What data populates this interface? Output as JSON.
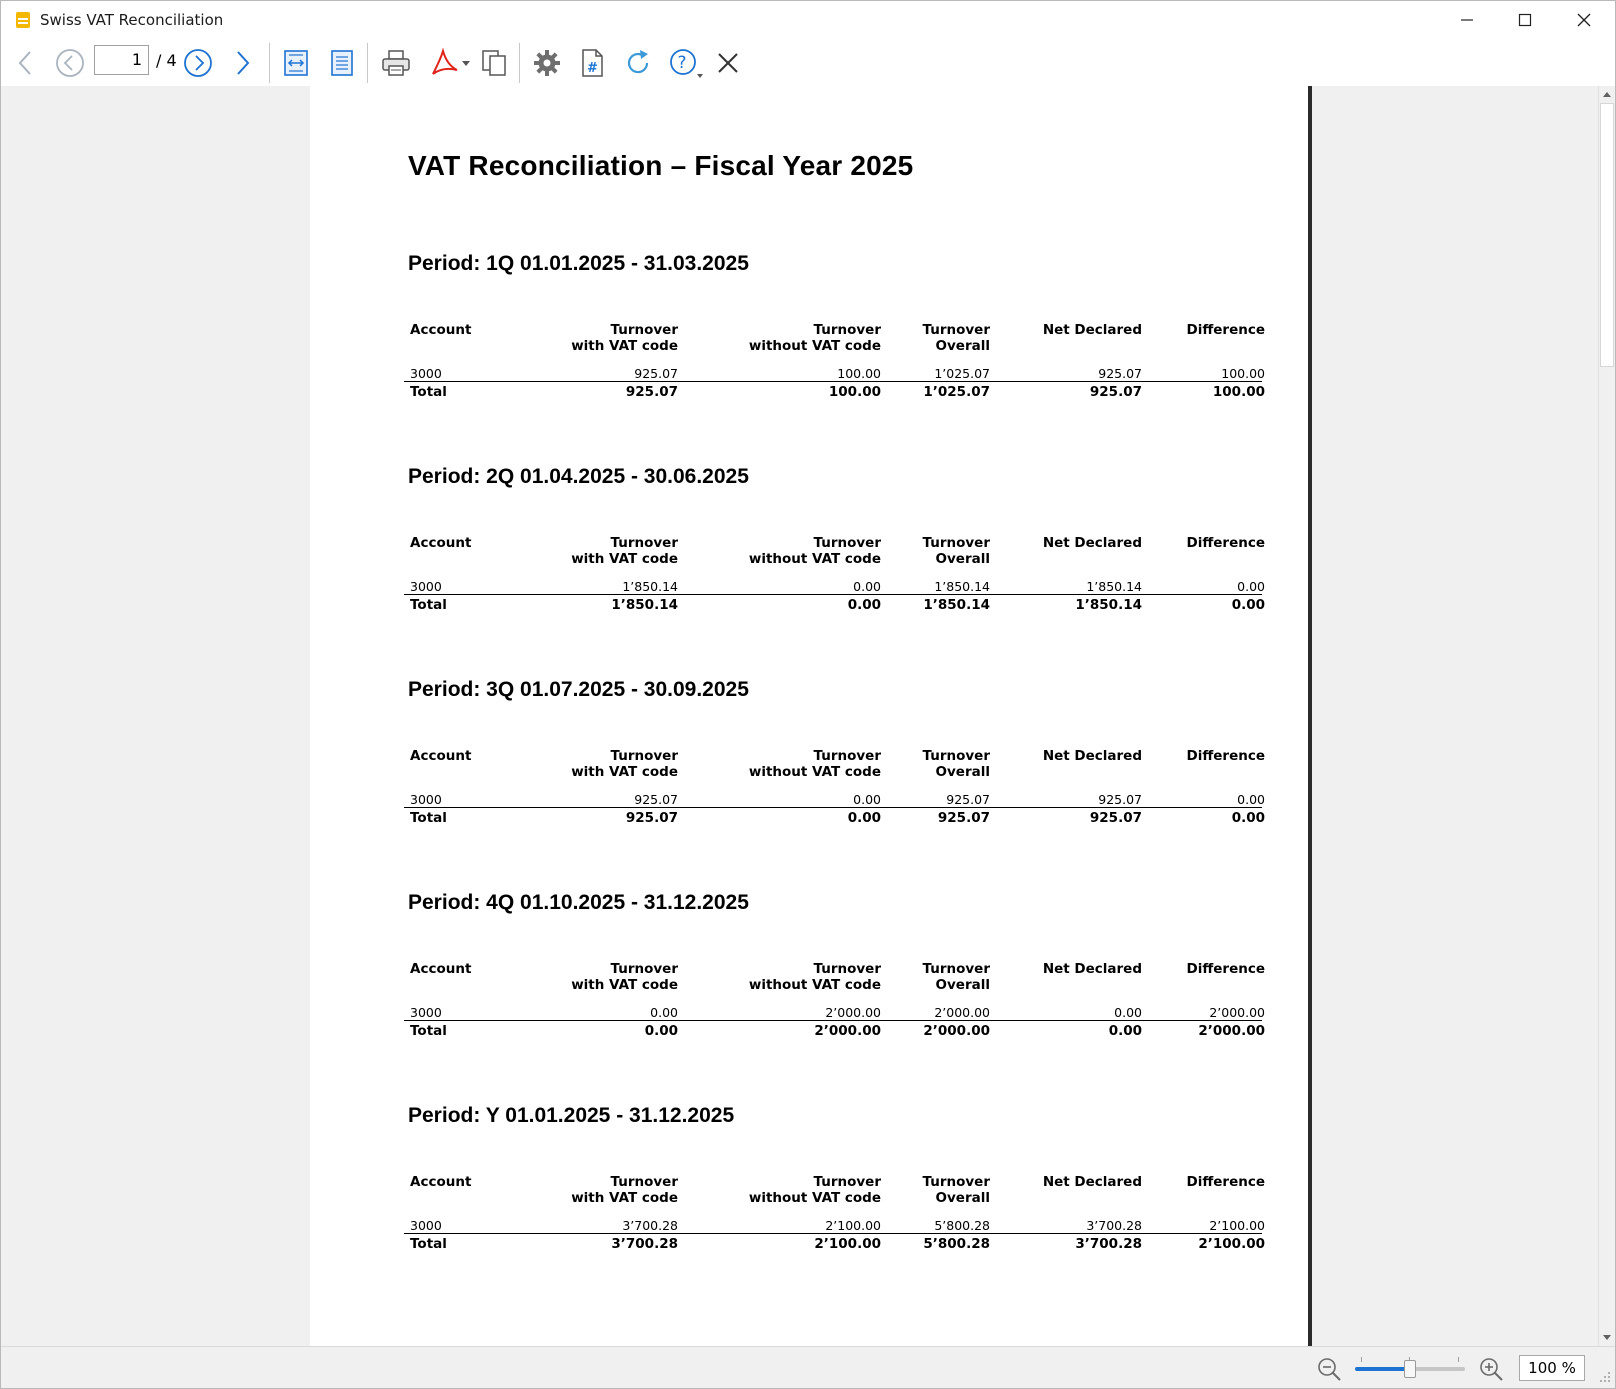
{
  "window": {
    "title": "Swiss VAT Reconciliation"
  },
  "toolbar": {
    "page_current": "1",
    "page_total": "/ 4",
    "icons": [
      "arrow-left-icon",
      "circle-arrow-left-icon",
      "circle-arrow-right-icon",
      "arrow-right-icon",
      "fit-width-icon",
      "fit-page-icon",
      "print-icon",
      "pdf-export-icon",
      "copy-pages-icon",
      "settings-gear-icon",
      "page-number-icon",
      "refresh-icon",
      "help-icon",
      "close-icon"
    ]
  },
  "document": {
    "title": "VAT Reconciliation – Fiscal Year 2025",
    "columns": {
      "account": "Account",
      "with_vat_1": "Turnover",
      "with_vat_2": "with VAT code",
      "without_vat_1": "Turnover",
      "without_vat_2": "without VAT code",
      "overall_1": "Turnover",
      "overall_2": "Overall",
      "net_declared": "Net Declared",
      "difference": "Difference"
    },
    "periods": [
      {
        "title": "Period: 1Q 01.01.2025 - 31.03.2025",
        "row": {
          "account": "3000",
          "with_vat": "925.07",
          "without_vat": "100.00",
          "overall": "1’025.07",
          "net_declared": "925.07",
          "difference": "100.00"
        },
        "total": {
          "label": "Total",
          "with_vat": "925.07",
          "without_vat": "100.00",
          "overall": "1’025.07",
          "net_declared": "925.07",
          "difference": "100.00"
        }
      },
      {
        "title": "Period: 2Q 01.04.2025 - 30.06.2025",
        "row": {
          "account": "3000",
          "with_vat": "1’850.14",
          "without_vat": "0.00",
          "overall": "1’850.14",
          "net_declared": "1’850.14",
          "difference": "0.00"
        },
        "total": {
          "label": "Total",
          "with_vat": "1’850.14",
          "without_vat": "0.00",
          "overall": "1’850.14",
          "net_declared": "1’850.14",
          "difference": "0.00"
        }
      },
      {
        "title": "Period: 3Q 01.07.2025 - 30.09.2025",
        "row": {
          "account": "3000",
          "with_vat": "925.07",
          "without_vat": "0.00",
          "overall": "925.07",
          "net_declared": "925.07",
          "difference": "0.00"
        },
        "total": {
          "label": "Total",
          "with_vat": "925.07",
          "without_vat": "0.00",
          "overall": "925.07",
          "net_declared": "925.07",
          "difference": "0.00"
        }
      },
      {
        "title": "Period: 4Q 01.10.2025 - 31.12.2025",
        "row": {
          "account": "3000",
          "with_vat": "0.00",
          "without_vat": "2’000.00",
          "overall": "2’000.00",
          "net_declared": "0.00",
          "difference": "2’000.00"
        },
        "total": {
          "label": "Total",
          "with_vat": "0.00",
          "without_vat": "2’000.00",
          "overall": "2’000.00",
          "net_declared": "0.00",
          "difference": "2’000.00"
        }
      },
      {
        "title": "Period: Y 01.01.2025 - 31.12.2025",
        "row": {
          "account": "3000",
          "with_vat": "3’700.28",
          "without_vat": "2’100.00",
          "overall": "5’800.28",
          "net_declared": "3’700.28",
          "difference": "2’100.00"
        },
        "total": {
          "label": "Total",
          "with_vat": "3’700.28",
          "without_vat": "2’100.00",
          "overall": "5’800.28",
          "net_declared": "3’700.28",
          "difference": "2’100.00"
        }
      }
    ]
  },
  "statusbar": {
    "zoom_value": "100 %",
    "zoom_slider_fraction": 0.5
  },
  "colors": {
    "accent_blue": "#1e73d2",
    "pdf_red": "#e0241b",
    "app_icon_yellow": "#f5b800"
  }
}
